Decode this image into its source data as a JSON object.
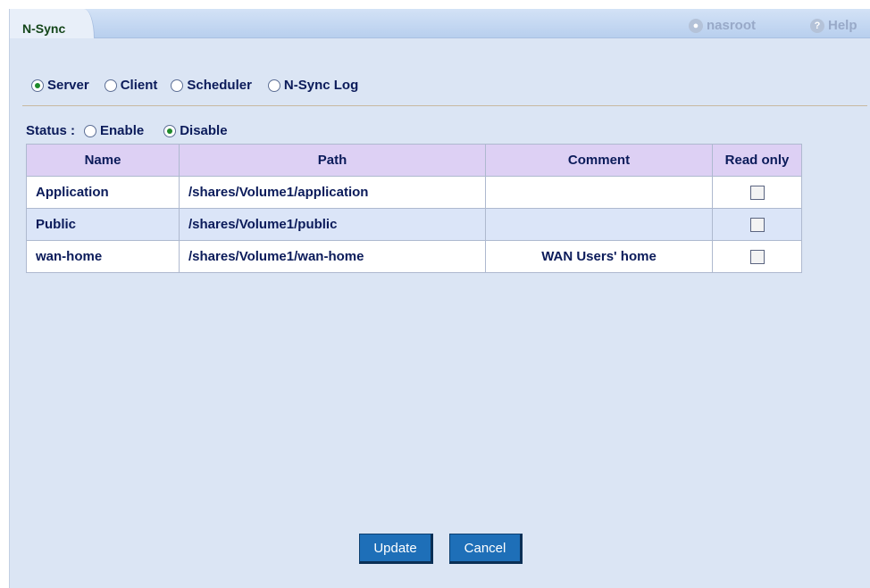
{
  "header": {
    "tab_label": "N-Sync",
    "user_label": "nasroot",
    "help_label": "Help"
  },
  "mode": {
    "options": [
      {
        "label": "Server",
        "selected": true
      },
      {
        "label": "Client",
        "selected": false
      },
      {
        "label": "Scheduler",
        "selected": false
      },
      {
        "label": "N-Sync Log",
        "selected": false
      }
    ]
  },
  "status": {
    "label": "Status :",
    "options": [
      {
        "label": "Enable",
        "selected": false
      },
      {
        "label": "Disable",
        "selected": true
      }
    ]
  },
  "table": {
    "headers": [
      "Name",
      "Path",
      "Comment",
      "Read only"
    ],
    "rows": [
      {
        "name": "Application",
        "path": "/shares/Volume1/application",
        "comment": "",
        "read_only": false
      },
      {
        "name": "Public",
        "path": "/shares/Volume1/public",
        "comment": "",
        "read_only": false
      },
      {
        "name": "wan-home",
        "path": "/shares/Volume1/wan-home",
        "comment": "WAN Users' home",
        "read_only": false
      }
    ]
  },
  "buttons": {
    "update": "Update",
    "cancel": "Cancel"
  },
  "colors": {
    "panel_bg": "#dbe5f4",
    "header_row": "#ddd0f4",
    "alt_row": "#dbe5f8",
    "button": "#1e6fb8",
    "tab_text": "#14461a"
  }
}
